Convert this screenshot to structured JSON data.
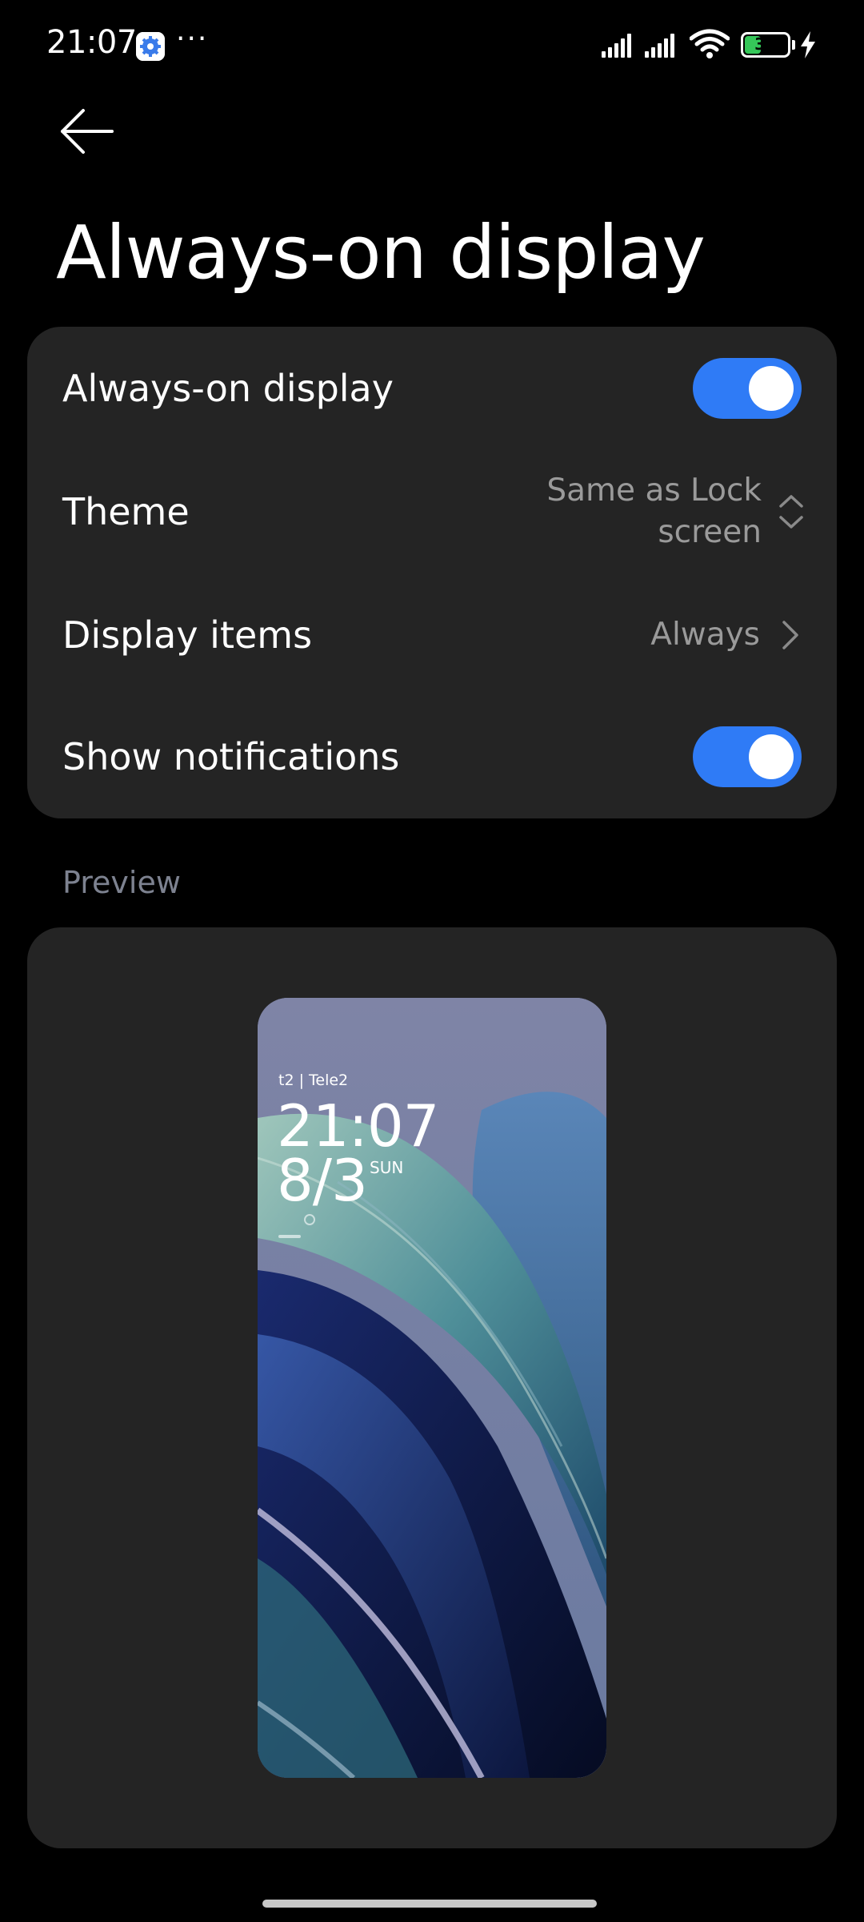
{
  "status_bar": {
    "time": "21:07",
    "more_indicator": "···",
    "battery_level": "36",
    "icons": [
      "settings-icon",
      "signal-icon",
      "signal-icon",
      "wifi-icon",
      "battery-icon",
      "charging-icon"
    ]
  },
  "header": {
    "title": "Always-on display"
  },
  "settings": {
    "always_on": {
      "label": "Always-on display",
      "enabled": true
    },
    "theme": {
      "label": "Theme",
      "value_line1": "Same as Lock",
      "value_line2": "screen"
    },
    "display_items": {
      "label": "Display items",
      "value": "Always"
    },
    "show_notifications": {
      "label": "Show notifications",
      "enabled": true
    }
  },
  "preview": {
    "section_label": "Preview",
    "carrier": "t2 | Tele2",
    "time": "21:07",
    "date": "8/3",
    "day": "SUN"
  },
  "colors": {
    "background": "#000000",
    "card": "#242424",
    "accent": "#2f7bf6",
    "secondary_text": "#9a9a9a",
    "section_label": "#7d8290",
    "battery_fill": "#35c759"
  }
}
